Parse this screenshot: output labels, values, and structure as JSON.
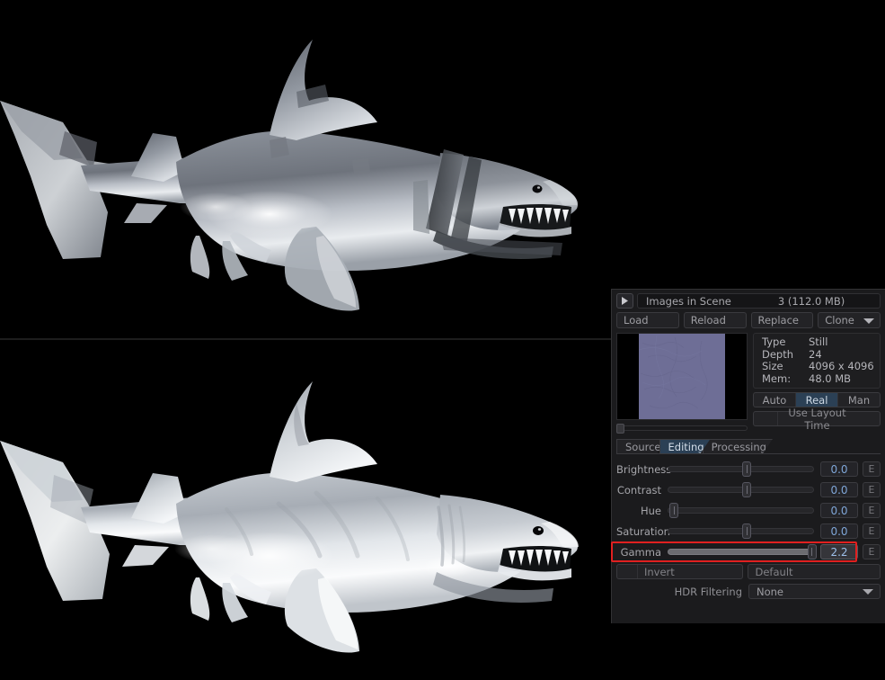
{
  "viewports": {
    "top": {
      "name": "render-shaded-textured",
      "background": "#000000",
      "subject": "shark-3d-model"
    },
    "bottom": {
      "name": "render-smooth-shaded",
      "background": "#000000",
      "subject": "shark-3d-model"
    }
  },
  "panel": {
    "header": {
      "expand_icon": "triangle-right-icon",
      "label": "Images in Scene",
      "count": "3 (112.0 MB)"
    },
    "actions": {
      "load": "Load",
      "reload": "Reload",
      "replace": "Replace",
      "clone": "Clone",
      "clone_caret": "chevron-down-icon"
    },
    "preview": {
      "swatch_color": "#6e6e96",
      "scrollbar": "horizontal-scrollbar"
    },
    "info": {
      "rows": [
        {
          "key": "Type",
          "value": "Still"
        },
        {
          "key": "Depth",
          "value": "24"
        },
        {
          "key": "Size",
          "value": "4096 x 4096"
        },
        {
          "key": "Mem:",
          "value": "48.0 MB"
        }
      ]
    },
    "mode_segment": {
      "options": [
        "Auto",
        "Real",
        "Man"
      ],
      "selected": "Real",
      "selected_color": "#2b4055"
    },
    "layout_time_button": "Use Layout Time",
    "tabs": [
      {
        "label": "Source",
        "active": false
      },
      {
        "label": "Editing",
        "active": true
      },
      {
        "label": "Processing",
        "active": false
      }
    ],
    "sliders": [
      {
        "label": "Brightness",
        "value": "0.0",
        "pos": 51,
        "filled": false,
        "highlight": false,
        "edit": "E"
      },
      {
        "label": "Contrast",
        "value": "0.0",
        "pos": 51,
        "filled": false,
        "highlight": false,
        "edit": "E"
      },
      {
        "label": "Hue",
        "value": "0.0",
        "pos": 1.5,
        "filled": false,
        "highlight": false,
        "edit": "E"
      },
      {
        "label": "Saturation",
        "value": "0.0",
        "pos": 51,
        "filled": false,
        "highlight": false,
        "edit": "E"
      },
      {
        "label": "Gamma",
        "value": "2.2",
        "pos": 95.5,
        "filled": true,
        "highlight": true,
        "edit": "E"
      }
    ],
    "invert_button": "Invert",
    "default_button": "Default",
    "hdr_filtering": {
      "label": "HDR Filtering",
      "value": "None",
      "caret": "chevron-down-icon"
    },
    "accent_highlight_color": "#e02020",
    "value_text_color": "#7fa6d8"
  }
}
